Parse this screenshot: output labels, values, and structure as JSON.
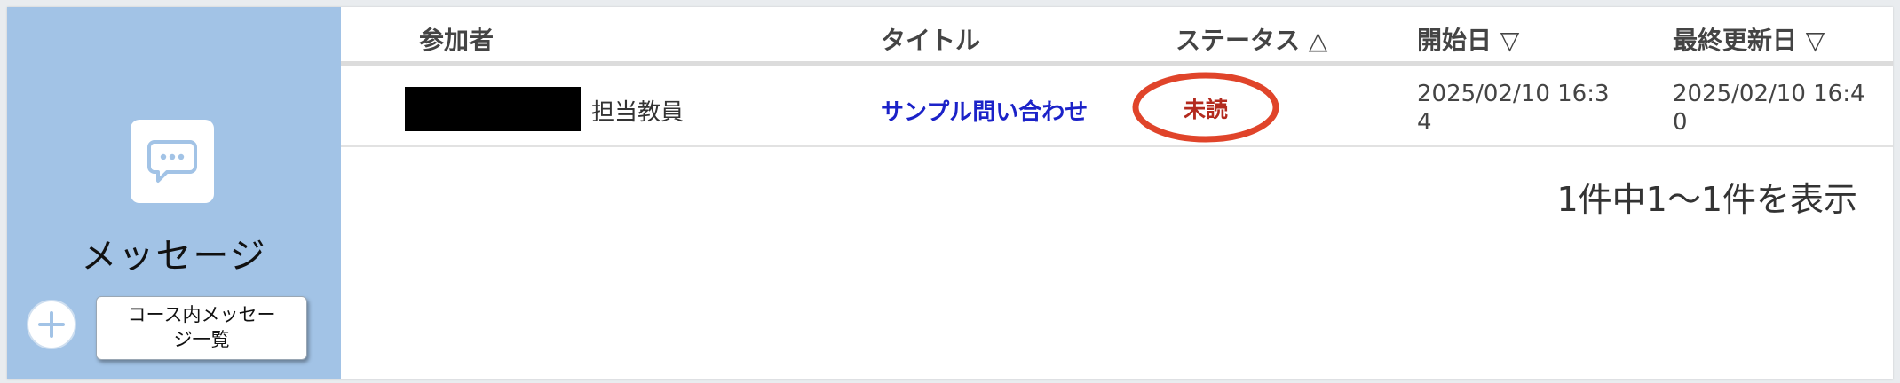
{
  "sidebar": {
    "title": "メッセージ",
    "icon": "chat-bubble-icon",
    "add_icon": "plus-icon",
    "list_button": {
      "line1": "コース内メッセー",
      "line2": "ジ一覧"
    }
  },
  "table": {
    "columns": {
      "participant": "参加者",
      "title": "タイトル",
      "status": "ステータス △",
      "start_date": "開始日 ▽",
      "updated_date": "最終更新日 ▽"
    },
    "rows": [
      {
        "participant_role": "担当教員",
        "title": "サンプル問い合わせ",
        "status": "未読",
        "start_date_line1": "2025/02/10 16:3",
        "start_date_line2": "4",
        "updated_date_line1": "2025/02/10 16:4",
        "updated_date_line2": "0"
      }
    ],
    "count_text": "1件中1〜1件を表示"
  },
  "colors": {
    "sidebar_bg": "#a2c3e6",
    "link": "#1b22c8",
    "status_text": "#b32a1e",
    "annotation_circle": "#e0442a"
  }
}
